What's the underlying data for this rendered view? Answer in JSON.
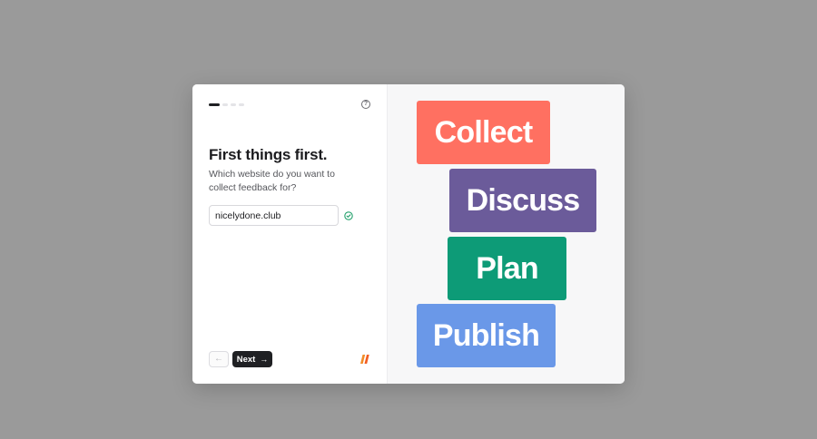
{
  "progress": {
    "current_step": 1,
    "total_steps": 4
  },
  "header": {
    "help_icon": "question-circle-icon",
    "help_glyph": "?"
  },
  "main": {
    "title": "First things first.",
    "subtitle": "Which website do you want to collect feedback for?",
    "website_input": {
      "value": "nicelydone.club",
      "valid": true
    }
  },
  "footer": {
    "back_glyph": "←",
    "next_label": "Next",
    "next_glyph": "→",
    "logo_colors": [
      "#f28c28",
      "#f25d22"
    ]
  },
  "showcase": {
    "words": [
      {
        "label": "Collect",
        "color": "#ff7061"
      },
      {
        "label": "Discuss",
        "color": "#6b5b9a"
      },
      {
        "label": "Plan",
        "color": "#0d9b77"
      },
      {
        "label": "Publish",
        "color": "#6a98e8"
      }
    ]
  },
  "colors": {
    "success": "#22a06b",
    "primary_button": "#1f2023"
  }
}
